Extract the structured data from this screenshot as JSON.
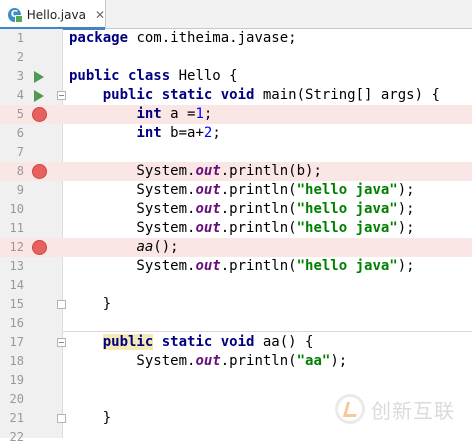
{
  "tab": {
    "icon_letter": "C",
    "filename": "Hello.java",
    "close_glyph": "✕"
  },
  "watermark": {
    "text": "创新互联"
  },
  "lines": [
    {
      "n": "1",
      "segs": [
        [
          "kw",
          "package"
        ],
        [
          "t",
          " com.itheima.javase;"
        ]
      ]
    },
    {
      "n": "2",
      "segs": []
    },
    {
      "n": "3",
      "run": true,
      "segs": [
        [
          "kw",
          "public class"
        ],
        [
          "t",
          " Hello {"
        ]
      ]
    },
    {
      "n": "4",
      "run": true,
      "fold": "open",
      "segs": [
        [
          "t",
          "    "
        ],
        [
          "kw",
          "public static void"
        ],
        [
          "t",
          " main(String[] args) {"
        ]
      ]
    },
    {
      "n": "5",
      "bp": true,
      "segs": [
        [
          "t",
          "        "
        ],
        [
          "kw",
          "int"
        ],
        [
          "t",
          " a ="
        ],
        [
          "num",
          "1"
        ],
        [
          "t",
          ";"
        ]
      ]
    },
    {
      "n": "6",
      "segs": [
        [
          "t",
          "        "
        ],
        [
          "kw",
          "int"
        ],
        [
          "t",
          " b=a+"
        ],
        [
          "num",
          "2"
        ],
        [
          "t",
          ";"
        ]
      ]
    },
    {
      "n": "7",
      "segs": []
    },
    {
      "n": "8",
      "bp": true,
      "segs": [
        [
          "t",
          "        System."
        ],
        [
          "fld",
          "out"
        ],
        [
          "t",
          ".println(b);"
        ]
      ]
    },
    {
      "n": "9",
      "segs": [
        [
          "t",
          "        System."
        ],
        [
          "fld",
          "out"
        ],
        [
          "t",
          ".println("
        ],
        [
          "str",
          "\"hello java\""
        ],
        [
          "t",
          ");"
        ]
      ]
    },
    {
      "n": "10",
      "segs": [
        [
          "t",
          "        System."
        ],
        [
          "fld",
          "out"
        ],
        [
          "t",
          ".println("
        ],
        [
          "str",
          "\"hello java\""
        ],
        [
          "t",
          ");"
        ]
      ]
    },
    {
      "n": "11",
      "segs": [
        [
          "t",
          "        System."
        ],
        [
          "fld",
          "out"
        ],
        [
          "t",
          ".println("
        ],
        [
          "str",
          "\"hello java\""
        ],
        [
          "t",
          ");"
        ]
      ]
    },
    {
      "n": "12",
      "bp": true,
      "segs": [
        [
          "t",
          "        "
        ],
        [
          "it",
          "aa"
        ],
        [
          "t",
          "();"
        ]
      ]
    },
    {
      "n": "13",
      "segs": [
        [
          "t",
          "        System."
        ],
        [
          "fld",
          "out"
        ],
        [
          "t",
          ".println("
        ],
        [
          "str",
          "\"hello java\""
        ],
        [
          "t",
          ");"
        ]
      ]
    },
    {
      "n": "14",
      "segs": []
    },
    {
      "n": "15",
      "fold": "close",
      "segs": [
        [
          "t",
          "    }"
        ]
      ]
    },
    {
      "n": "16",
      "segs": []
    },
    {
      "n": "17",
      "fold": "open",
      "segs": [
        [
          "t",
          "    "
        ],
        [
          "kwhl",
          "public"
        ],
        [
          "t",
          " "
        ],
        [
          "kw",
          "static void"
        ],
        [
          "t",
          " aa() {"
        ]
      ]
    },
    {
      "n": "18",
      "segs": [
        [
          "t",
          "        System."
        ],
        [
          "fld",
          "out"
        ],
        [
          "t",
          ".println("
        ],
        [
          "str",
          "\"aa\""
        ],
        [
          "t",
          ");"
        ]
      ]
    },
    {
      "n": "19",
      "segs": []
    },
    {
      "n": "20",
      "segs": []
    },
    {
      "n": "21",
      "fold": "close",
      "segs": [
        [
          "t",
          "    }"
        ]
      ]
    },
    {
      "n": "22",
      "segs": []
    }
  ]
}
